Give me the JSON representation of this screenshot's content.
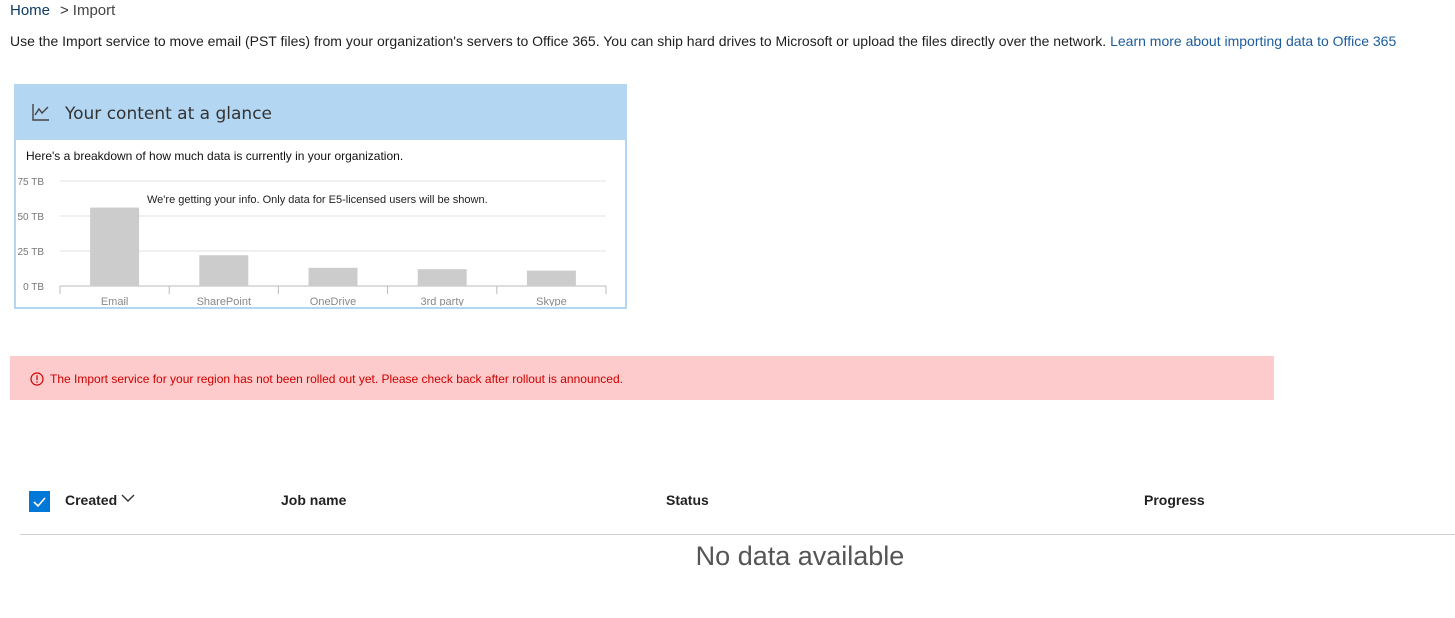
{
  "breadcrumb": {
    "home": "Home",
    "separator": ">",
    "current": "Import"
  },
  "intro": {
    "text": "Use the Import service to move email (PST files) from your organization's servers to Office 365. You can ship hard drives to Microsoft or upload the files directly over the network.",
    "link_text": "Learn more about importing data to Office 365"
  },
  "card": {
    "icon": "line-chart-icon",
    "title": "Your content at a glance",
    "description": "Here's a breakdown of how much data is currently in your organization.",
    "loading_message": "We're getting your info. Only data for E5-licensed users will be shown."
  },
  "chart_data": {
    "type": "bar",
    "categories": [
      "Email",
      "SharePoint",
      "OneDrive",
      "3rd party",
      "Skype"
    ],
    "values": [
      56,
      22,
      13,
      12,
      11
    ],
    "ytick_labels": [
      "0 TB",
      "25 TB",
      "50 TB",
      "75 TB"
    ],
    "ylim": [
      0,
      75
    ],
    "yticks": [
      0,
      25,
      50,
      75
    ],
    "grid": true,
    "bar_color": "#cccccc"
  },
  "error": {
    "icon": "alert-circle-icon",
    "message": "The Import service for your region has not been rolled out yet. Please check back after rollout is announced.",
    "text_color": "#cc0000",
    "background": "#fdcbcb"
  },
  "table": {
    "columns": {
      "created": "Created",
      "job_name": "Job name",
      "status": "Status",
      "progress": "Progress"
    },
    "sort_icon": "chevron-down-icon",
    "select_all_checked": true,
    "empty_message": "No data available"
  },
  "colors": {
    "accent": "#0078d7",
    "link": "#1c5c9c",
    "card_header": "#b3d6f2"
  }
}
